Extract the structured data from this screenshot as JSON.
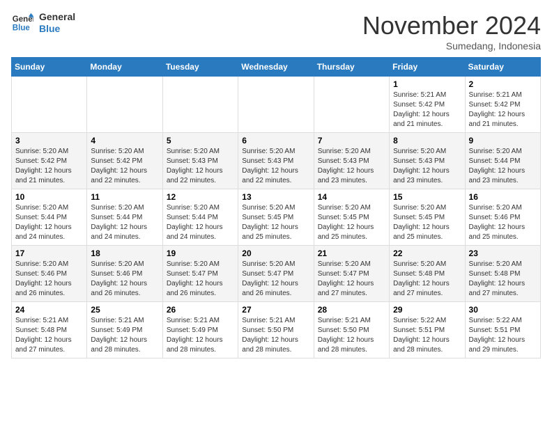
{
  "header": {
    "logo_line1": "General",
    "logo_line2": "Blue",
    "month": "November 2024",
    "location": "Sumedang, Indonesia"
  },
  "days_of_week": [
    "Sunday",
    "Monday",
    "Tuesday",
    "Wednesday",
    "Thursday",
    "Friday",
    "Saturday"
  ],
  "weeks": [
    [
      {
        "day": "",
        "info": ""
      },
      {
        "day": "",
        "info": ""
      },
      {
        "day": "",
        "info": ""
      },
      {
        "day": "",
        "info": ""
      },
      {
        "day": "",
        "info": ""
      },
      {
        "day": "1",
        "info": "Sunrise: 5:21 AM\nSunset: 5:42 PM\nDaylight: 12 hours\nand 21 minutes."
      },
      {
        "day": "2",
        "info": "Sunrise: 5:21 AM\nSunset: 5:42 PM\nDaylight: 12 hours\nand 21 minutes."
      }
    ],
    [
      {
        "day": "3",
        "info": "Sunrise: 5:20 AM\nSunset: 5:42 PM\nDaylight: 12 hours\nand 21 minutes."
      },
      {
        "day": "4",
        "info": "Sunrise: 5:20 AM\nSunset: 5:42 PM\nDaylight: 12 hours\nand 22 minutes."
      },
      {
        "day": "5",
        "info": "Sunrise: 5:20 AM\nSunset: 5:43 PM\nDaylight: 12 hours\nand 22 minutes."
      },
      {
        "day": "6",
        "info": "Sunrise: 5:20 AM\nSunset: 5:43 PM\nDaylight: 12 hours\nand 22 minutes."
      },
      {
        "day": "7",
        "info": "Sunrise: 5:20 AM\nSunset: 5:43 PM\nDaylight: 12 hours\nand 23 minutes."
      },
      {
        "day": "8",
        "info": "Sunrise: 5:20 AM\nSunset: 5:43 PM\nDaylight: 12 hours\nand 23 minutes."
      },
      {
        "day": "9",
        "info": "Sunrise: 5:20 AM\nSunset: 5:44 PM\nDaylight: 12 hours\nand 23 minutes."
      }
    ],
    [
      {
        "day": "10",
        "info": "Sunrise: 5:20 AM\nSunset: 5:44 PM\nDaylight: 12 hours\nand 24 minutes."
      },
      {
        "day": "11",
        "info": "Sunrise: 5:20 AM\nSunset: 5:44 PM\nDaylight: 12 hours\nand 24 minutes."
      },
      {
        "day": "12",
        "info": "Sunrise: 5:20 AM\nSunset: 5:44 PM\nDaylight: 12 hours\nand 24 minutes."
      },
      {
        "day": "13",
        "info": "Sunrise: 5:20 AM\nSunset: 5:45 PM\nDaylight: 12 hours\nand 25 minutes."
      },
      {
        "day": "14",
        "info": "Sunrise: 5:20 AM\nSunset: 5:45 PM\nDaylight: 12 hours\nand 25 minutes."
      },
      {
        "day": "15",
        "info": "Sunrise: 5:20 AM\nSunset: 5:45 PM\nDaylight: 12 hours\nand 25 minutes."
      },
      {
        "day": "16",
        "info": "Sunrise: 5:20 AM\nSunset: 5:46 PM\nDaylight: 12 hours\nand 25 minutes."
      }
    ],
    [
      {
        "day": "17",
        "info": "Sunrise: 5:20 AM\nSunset: 5:46 PM\nDaylight: 12 hours\nand 26 minutes."
      },
      {
        "day": "18",
        "info": "Sunrise: 5:20 AM\nSunset: 5:46 PM\nDaylight: 12 hours\nand 26 minutes."
      },
      {
        "day": "19",
        "info": "Sunrise: 5:20 AM\nSunset: 5:47 PM\nDaylight: 12 hours\nand 26 minutes."
      },
      {
        "day": "20",
        "info": "Sunrise: 5:20 AM\nSunset: 5:47 PM\nDaylight: 12 hours\nand 26 minutes."
      },
      {
        "day": "21",
        "info": "Sunrise: 5:20 AM\nSunset: 5:47 PM\nDaylight: 12 hours\nand 27 minutes."
      },
      {
        "day": "22",
        "info": "Sunrise: 5:20 AM\nSunset: 5:48 PM\nDaylight: 12 hours\nand 27 minutes."
      },
      {
        "day": "23",
        "info": "Sunrise: 5:20 AM\nSunset: 5:48 PM\nDaylight: 12 hours\nand 27 minutes."
      }
    ],
    [
      {
        "day": "24",
        "info": "Sunrise: 5:21 AM\nSunset: 5:48 PM\nDaylight: 12 hours\nand 27 minutes."
      },
      {
        "day": "25",
        "info": "Sunrise: 5:21 AM\nSunset: 5:49 PM\nDaylight: 12 hours\nand 28 minutes."
      },
      {
        "day": "26",
        "info": "Sunrise: 5:21 AM\nSunset: 5:49 PM\nDaylight: 12 hours\nand 28 minutes."
      },
      {
        "day": "27",
        "info": "Sunrise: 5:21 AM\nSunset: 5:50 PM\nDaylight: 12 hours\nand 28 minutes."
      },
      {
        "day": "28",
        "info": "Sunrise: 5:21 AM\nSunset: 5:50 PM\nDaylight: 12 hours\nand 28 minutes."
      },
      {
        "day": "29",
        "info": "Sunrise: 5:22 AM\nSunset: 5:51 PM\nDaylight: 12 hours\nand 28 minutes."
      },
      {
        "day": "30",
        "info": "Sunrise: 5:22 AM\nSunset: 5:51 PM\nDaylight: 12 hours\nand 29 minutes."
      }
    ]
  ]
}
